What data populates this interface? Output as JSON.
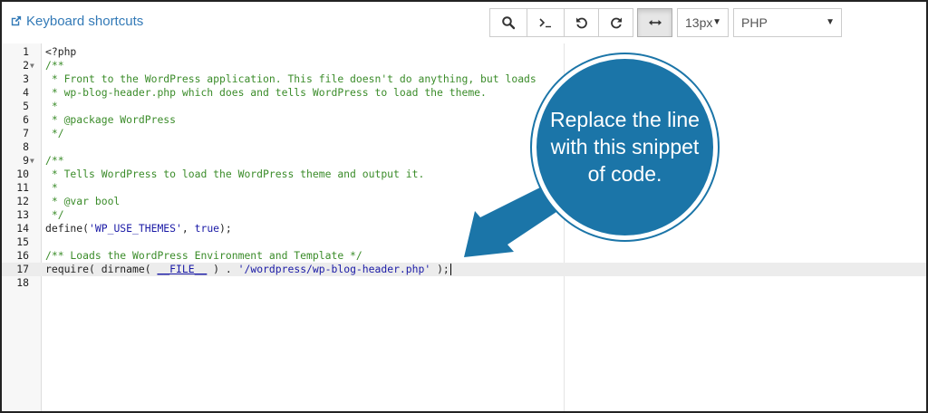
{
  "toolbar": {
    "keyboard_shortcuts": "Keyboard shortcuts",
    "font_size": "13px",
    "language": "PHP",
    "buttons": [
      "search",
      "terminal",
      "undo",
      "redo",
      "wrap"
    ]
  },
  "editor": {
    "lines": [
      "<?php",
      "/**",
      " * Front to the WordPress application. This file doesn't do anything, but loads",
      " * wp-blog-header.php which does and tells WordPress to load the theme.",
      " *",
      " * @package WordPress",
      " */",
      "",
      "/**",
      " * Tells WordPress to load the WordPress theme and output it.",
      " *",
      " * @var bool",
      " */",
      "define('WP_USE_THEMES', true);",
      "",
      "/** Loads the WordPress Environment and Template */",
      "require( dirname( __FILE__ ) . '/wordpress/wp-blog-header.php' );",
      ""
    ],
    "line_numbers": [
      "1",
      "2",
      "3",
      "4",
      "5",
      "6",
      "7",
      "8",
      "9",
      "10",
      "11",
      "12",
      "13",
      "14",
      "15",
      "16",
      "17",
      "18"
    ],
    "highlighted_line": 17
  },
  "callout": {
    "text": "Replace the line with this snippet of code."
  },
  "colors": {
    "link": "#337ab7",
    "comment": "#3b8c2a",
    "string": "#1a1aa6",
    "callout": "#1b75a8"
  }
}
